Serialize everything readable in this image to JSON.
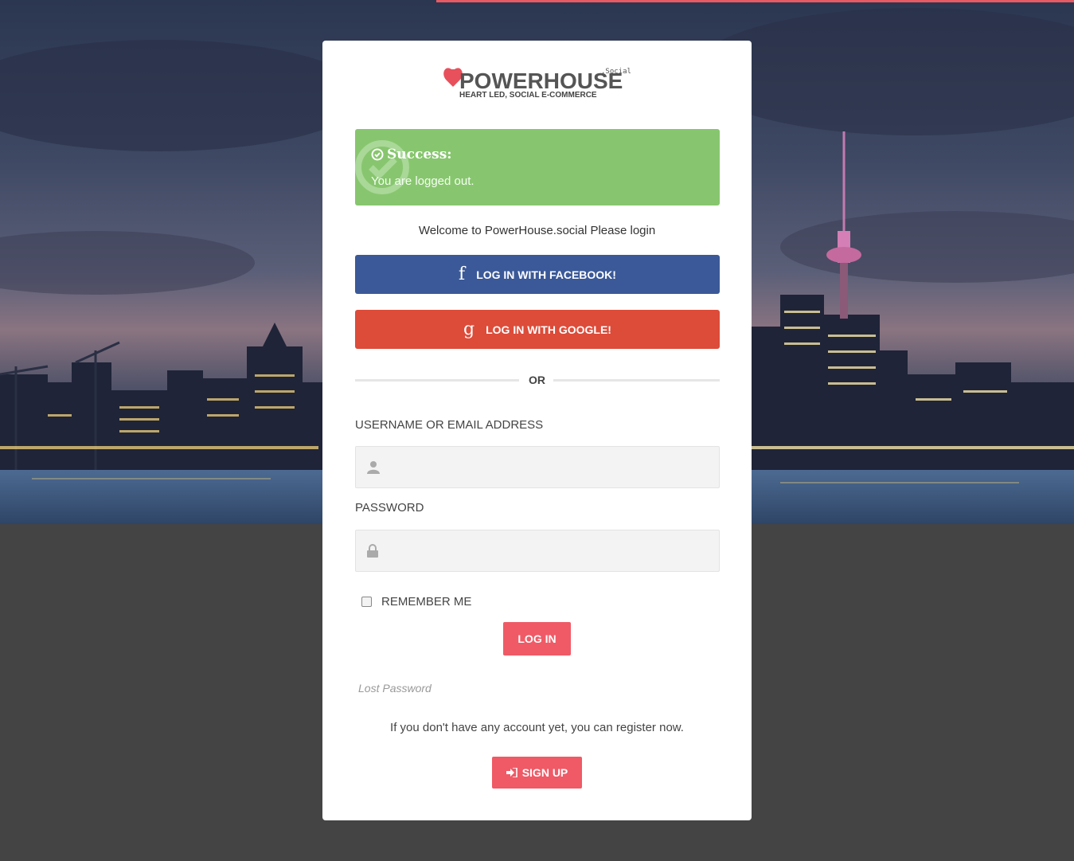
{
  "colors": {
    "accent": "#ef5a66",
    "facebook": "#3b5998",
    "google": "#dd4b39",
    "success": "#87c66e",
    "page_bg": "#444444"
  },
  "logo": {
    "brand_text": "POWERHOUSE",
    "suffix": ".Social",
    "tagline": "HEART LED, SOCIAL E-COMMERCE"
  },
  "alert": {
    "title": "Success:",
    "message": "You are logged out.",
    "icon": "check-circle-icon"
  },
  "welcome_text": "Welcome to PowerHouse.social Please login",
  "social": {
    "facebook_label": "LOG IN WITH FACEBOOK!",
    "facebook_icon": "f",
    "google_label": "LOG IN WITH GOOGLE!",
    "google_icon": "g"
  },
  "divider_text": "OR",
  "form": {
    "username_label": "USERNAME OR EMAIL ADDRESS",
    "username_value": "",
    "password_label": "PASSWORD",
    "password_value": "",
    "remember_label": "REMEMBER ME",
    "remember_checked": false,
    "login_label": "LOG IN"
  },
  "lost_password": "Lost Password",
  "register_text": "If you don't have any account yet, you can register now.",
  "signup_label": "SIGN UP"
}
